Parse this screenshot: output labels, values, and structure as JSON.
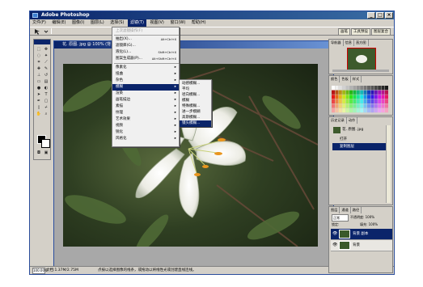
{
  "app": {
    "title": "Adobe Photoshop",
    "window_buttons": [
      "_",
      "□",
      "×"
    ]
  },
  "menubar": {
    "items": [
      "文件(F)",
      "编辑(E)",
      "图像(I)",
      "图层(L)",
      "选择(S)",
      "滤镜(T)",
      "视图(V)",
      "窗口(W)",
      "帮助(H)"
    ],
    "active_index": 5
  },
  "options_bar": {
    "palette_tabs": [
      "画笔",
      "工具预设",
      "图层复合"
    ]
  },
  "document": {
    "title": "花. 原图. jpg @ 100% (背",
    "zoom": "100.00%",
    "doc_size": "文档:1.37M/2.75M",
    "hint": "点按以选择图像的线条，或拖动以将线性光或创建直线连线。"
  },
  "filter_menu": {
    "items": [
      {
        "label": "抽出(X)...",
        "shortcut": "Alt+Ctrl+X"
      },
      {
        "label": "滤镜库(G)..."
      },
      {
        "label": "液化(L)...",
        "shortcut": "Shift+Ctrl+X"
      },
      {
        "label": "图案生成器(P)...",
        "shortcut": "Alt+Shift+Ctrl+X"
      },
      {
        "label": "像素化",
        "submenu": true
      },
      {
        "label": "扭曲",
        "submenu": true
      },
      {
        "label": "杂色",
        "submenu": true
      },
      {
        "label": "模糊",
        "submenu": true,
        "highlighted": true
      },
      {
        "label": "渲染",
        "submenu": true
      },
      {
        "label": "画笔描边",
        "submenu": true
      },
      {
        "label": "素描",
        "submenu": true
      },
      {
        "label": "纹理",
        "submenu": true
      },
      {
        "label": "艺术效果",
        "submenu": true
      },
      {
        "label": "视频",
        "submenu": true
      },
      {
        "label": "锐化",
        "submenu": true
      },
      {
        "label": "风格化",
        "submenu": true
      },
      {
        "label": "其它",
        "submenu": true
      },
      {
        "label": "Digimarc",
        "submenu": true
      }
    ],
    "top_label": "上次滤镜操作(F)"
  },
  "blur_submenu": {
    "items": [
      {
        "label": "动感模糊..."
      },
      {
        "label": "平均"
      },
      {
        "label": "径向模糊..."
      },
      {
        "label": "模糊"
      },
      {
        "label": "特殊模糊..."
      },
      {
        "label": "进一步模糊"
      },
      {
        "label": "高斯模糊..."
      },
      {
        "label": "镜头模糊...",
        "highlighted": true
      }
    ]
  },
  "navigator_panel": {
    "tabs": [
      "导航器",
      "信息",
      "直方图"
    ]
  },
  "swatches_panel": {
    "tabs": [
      "颜色",
      "色板",
      "样式"
    ]
  },
  "history_panel": {
    "tabs": [
      "历史记录",
      "动作"
    ],
    "document_label": "花. 原图. jpg",
    "rows": [
      {
        "label": "打开"
      },
      {
        "label": "复制图层",
        "selected": true
      }
    ]
  },
  "layers_panel": {
    "tabs": [
      "图层",
      "通道",
      "路径"
    ],
    "mode": "正常",
    "opacity_label": "不透明度: 100%",
    "lock_label": "锁定:",
    "fill_label": "填充: 100%",
    "layers": [
      {
        "name": "背景 副本",
        "selected": true
      },
      {
        "name": "背景",
        "selected": false
      }
    ]
  },
  "colors": {
    "titlebar": "#0a246a",
    "highlight": "#0a246a",
    "chrome": "#d4d0c8",
    "petal": "#f4f4ef",
    "stamen": "#e8951e"
  }
}
